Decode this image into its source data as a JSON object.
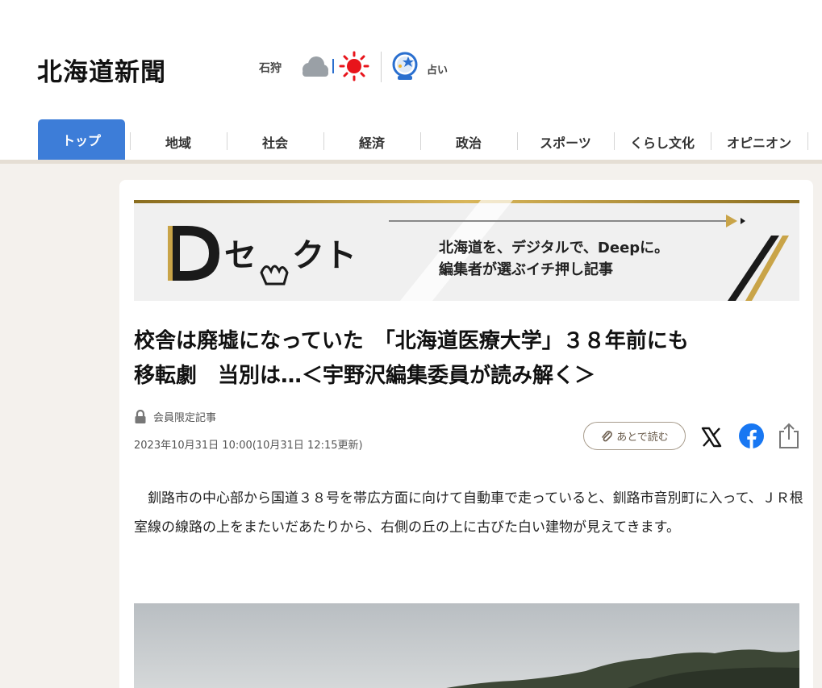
{
  "header": {
    "logo": "北海道新聞",
    "region": "石狩",
    "weather": [
      "cloud-icon",
      "sun-icon"
    ],
    "fortune_label": "占い"
  },
  "nav": {
    "tabs": [
      {
        "label": "トップ",
        "active": true
      },
      {
        "label": "地域"
      },
      {
        "label": "社会"
      },
      {
        "label": "経済"
      },
      {
        "label": "政治"
      },
      {
        "label": "スポーツ"
      },
      {
        "label": "くらし文化"
      },
      {
        "label": "オピニオン"
      }
    ]
  },
  "banner": {
    "brand": "Dセレクト",
    "line1": "北海道を、デジタルで、Deepに。",
    "line2": "編集者が選ぶイチ押し記事"
  },
  "article": {
    "title_line1": "校舎は廃墟になっていた　「北海道医療大学」３８年前にも",
    "title_line2": "移転劇　当別は…＜宇野沢編集委員が読み解く＞",
    "member_label": "会員限定記事",
    "date": "2023年10月31日 10:00(10月31日 12:15更新)",
    "read_later": "あとで読む",
    "body": "釧路市の中心部から国道３８号を帯広方面に向けて自動車で走っていると、釧路市音別町に入って、ＪＲ根室線の線路の上をまたいだあたりから、右側の丘の上に古びた白い建物が見えてきます。"
  },
  "colors": {
    "accent": "#3d7dd8",
    "accent_dark": "#1c4ea0",
    "gold": "#c9a448",
    "facebook": "#1877f2",
    "sun": "#e8141b"
  }
}
